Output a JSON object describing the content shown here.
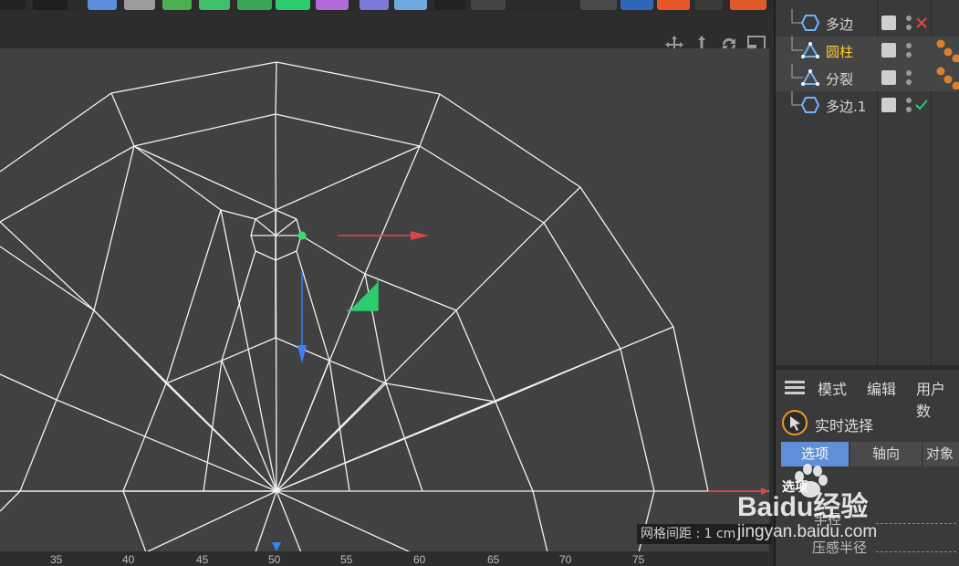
{
  "object_manager": {
    "items": [
      {
        "name": "多边",
        "icon": "polygon-icon",
        "status": "disabled-x"
      },
      {
        "name": "圆柱",
        "icon": "cylinder-icon",
        "status": "tag",
        "active": true
      },
      {
        "name": "分裂",
        "icon": "split-icon",
        "status": "tag"
      },
      {
        "name": "多边.1",
        "icon": "polygon-icon",
        "status": "enabled-check"
      }
    ]
  },
  "attributes": {
    "menu": [
      "模式",
      "编辑",
      "用户数"
    ],
    "tool_name": "实时选择",
    "tabs": [
      "选项",
      "轴向",
      "对象"
    ],
    "section_title": "选项",
    "fields": [
      "半径",
      "压感半径"
    ]
  },
  "viewport": {
    "grid_spacing": "网格间距 : 1 cm",
    "ruler_ticks": [
      "35",
      "40",
      "45",
      "50",
      "55",
      "60",
      "65",
      "70",
      "75"
    ]
  },
  "watermark": {
    "brand": "Baidu经验",
    "url": "jingyan.baidu.com"
  },
  "colors": {
    "x_axis": "#e04545",
    "y_axis": "#3b82f6",
    "z_axis": "#2ecc71",
    "selected": "#ffcc33"
  }
}
